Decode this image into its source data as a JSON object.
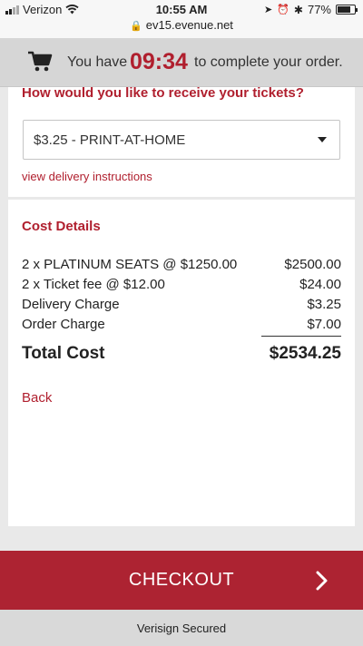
{
  "status_bar": {
    "carrier": "Verizon",
    "time": "10:55 AM",
    "battery": "77%"
  },
  "url_bar": {
    "url": "ev15.evenue.net"
  },
  "timer": {
    "prefix": "You have",
    "countdown": "09:34",
    "suffix": "to complete your order."
  },
  "delivery": {
    "question": "How would you like to receive your tickets?",
    "selected_option": "$3.25 - PRINT-AT-HOME",
    "instructions_link": "view delivery instructions"
  },
  "cost": {
    "title": "Cost Details",
    "lines": [
      {
        "label": "2 x PLATINUM SEATS @ $1250.00",
        "amount": "$2500.00"
      },
      {
        "label": "2 x Ticket fee @ $12.00",
        "amount": "$24.00"
      },
      {
        "label": "Delivery Charge",
        "amount": "$3.25"
      },
      {
        "label": "Order Charge",
        "amount": "$7.00"
      }
    ],
    "total_label": "Total Cost",
    "total_amount": "$2534.25",
    "back_link": "Back"
  },
  "checkout": {
    "label": "CHECKOUT"
  },
  "footer": {
    "text": "Verisign Secured"
  },
  "colors": {
    "accent": "#b01f2e",
    "checkout_bg": "#ad2332"
  }
}
